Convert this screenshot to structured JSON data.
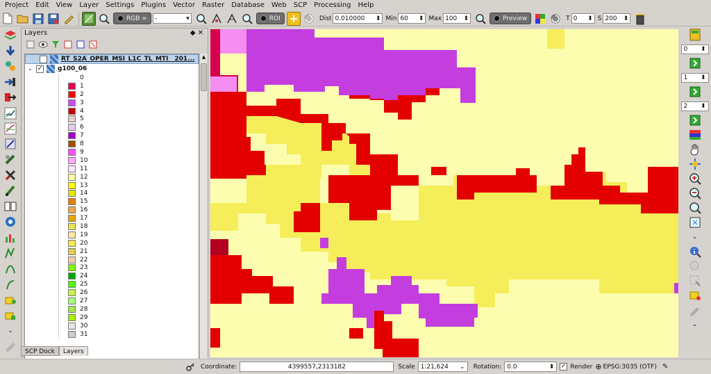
{
  "menubar": {
    "items": [
      "Project",
      "Edit",
      "View",
      "Layer",
      "Settings",
      "Plugins",
      "Vector",
      "Raster",
      "Database",
      "Web",
      "SCP",
      "Processing",
      "Help"
    ]
  },
  "toolbar": {
    "rgb_label": "RGB =",
    "band_select": "-",
    "roi_label": "ROI",
    "dist_label": "Dist",
    "dist_value": "0.010000",
    "min_label": "Min",
    "min_value": "60",
    "max_label": "Max",
    "max_value": "100",
    "preview_label": "Preview",
    "t_label": "T",
    "t_value": "0",
    "s_label": "S",
    "s_value": "200"
  },
  "layers_panel": {
    "title": "Layers",
    "header_icons": "◆ ✕",
    "layers": [
      {
        "name": "RT_S2A_OPER_MSI_L1C_TL_MTI__201...",
        "checked": false
      },
      {
        "name": "g100_06",
        "checked": true
      }
    ],
    "legend": [
      {
        "value": "0",
        "color": "#ffffff"
      },
      {
        "value": "1",
        "color": "#e6004d"
      },
      {
        "value": "2",
        "color": "#ff0000"
      },
      {
        "value": "3",
        "color": "#cc4df2"
      },
      {
        "value": "4",
        "color": "#cc0000"
      },
      {
        "value": "5",
        "color": "#e6cccc"
      },
      {
        "value": "6",
        "color": "#e6cce6"
      },
      {
        "value": "7",
        "color": "#a600cc"
      },
      {
        "value": "8",
        "color": "#a64d00"
      },
      {
        "value": "9",
        "color": "#ff4dff"
      },
      {
        "value": "10",
        "color": "#ffa6ff"
      },
      {
        "value": "11",
        "color": "#ffe6ff"
      },
      {
        "value": "12",
        "color": "#ffffa8"
      },
      {
        "value": "13",
        "color": "#ffff00"
      },
      {
        "value": "14",
        "color": "#e6e600"
      },
      {
        "value": "15",
        "color": "#e68000"
      },
      {
        "value": "16",
        "color": "#f2a64d"
      },
      {
        "value": "17",
        "color": "#e6a600"
      },
      {
        "value": "18",
        "color": "#e6e64d"
      },
      {
        "value": "19",
        "color": "#ffe6a6"
      },
      {
        "value": "20",
        "color": "#ffe64d"
      },
      {
        "value": "21",
        "color": "#e6cc4d"
      },
      {
        "value": "22",
        "color": "#f2cca6"
      },
      {
        "value": "23",
        "color": "#80ff00"
      },
      {
        "value": "24",
        "color": "#00a600"
      },
      {
        "value": "25",
        "color": "#4dff00"
      },
      {
        "value": "26",
        "color": "#ccf24d"
      },
      {
        "value": "27",
        "color": "#a6ff80"
      },
      {
        "value": "28",
        "color": "#a6e64d"
      },
      {
        "value": "29",
        "color": "#a6f200"
      },
      {
        "value": "30",
        "color": "#e6e6e6"
      },
      {
        "value": "31",
        "color": "#cccccc"
      }
    ]
  },
  "tabs": [
    "SCP Dock",
    "Layers"
  ],
  "right_toolbar": {
    "spin_values": [
      "0",
      "1",
      "2"
    ]
  },
  "statusbar": {
    "coordinate_label": "Coordinate:",
    "coordinate_value": "4399557,2313182",
    "scale_label": "Scale",
    "scale_value": "1:21,624",
    "rotation_label": "Rotation:",
    "rotation_value": "0.0",
    "render_label": "Render",
    "crs_label": "EPSG:3035 (OTF)"
  },
  "map_colors": {
    "background": "#fdfdb0",
    "yellow": "#f5ee5a",
    "red": "#e30000",
    "purple": "#c43ddf",
    "pink": "#f58ef0",
    "darkred": "#b3001e",
    "crimson": "#d6004d"
  }
}
